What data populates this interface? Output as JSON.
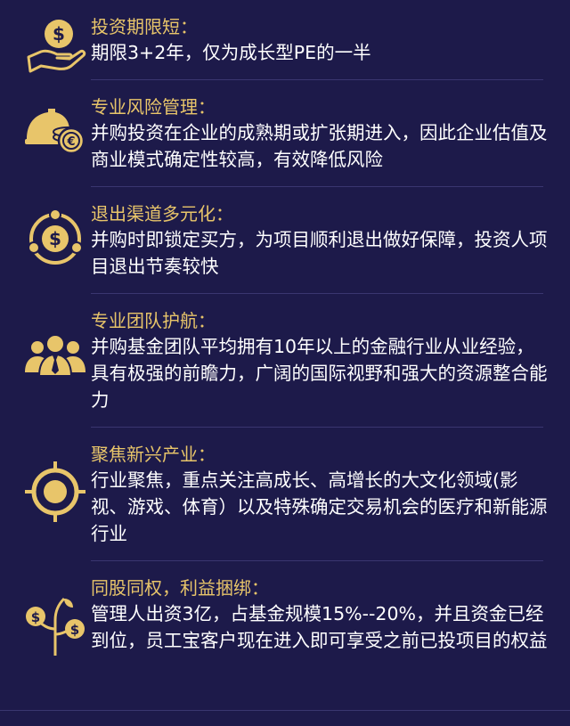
{
  "items": [
    {
      "icon": "hand-dollar-icon",
      "title": "投资期限短：",
      "desc": "期限3+2年，仅为成长型PE的一半"
    },
    {
      "icon": "helmet-coins-icon",
      "title": "专业风险管理：",
      "desc": "并购投资在企业的成熟期或扩张期进入，因此企业估值及商业模式确定性较高，有效降低风险"
    },
    {
      "icon": "dollar-cycle-icon",
      "title": "退出渠道多元化：",
      "desc": "并购时即锁定买方，为项目顺利退出做好保障，投资人项目退出节奏较快"
    },
    {
      "icon": "team-icon",
      "title": "专业团队护航：",
      "desc": "并购基金团队平均拥有10年以上的金融行业从业经验，具有极强的前瞻力，广阔的国际视野和强大的资源整合能力"
    },
    {
      "icon": "target-icon",
      "title": "聚焦新兴产业：",
      "desc": "行业聚焦，重点关注高成长、高增长的大文化领域(影视、游戏、体育）以及特殊确定交易机会的医疗和新能源行业"
    },
    {
      "icon": "money-tree-icon",
      "title": "同股同权，利益捆绑：",
      "desc": "管理人出资3亿，占基金规模15%--20%，并且资金已经到位，员工宝客户现在进入即可享受之前已投项目的权益"
    }
  ],
  "colors": {
    "background": "#1d1a4a",
    "accent": "#e8c56a",
    "text": "#ffffff",
    "divider": "#3a3670"
  }
}
